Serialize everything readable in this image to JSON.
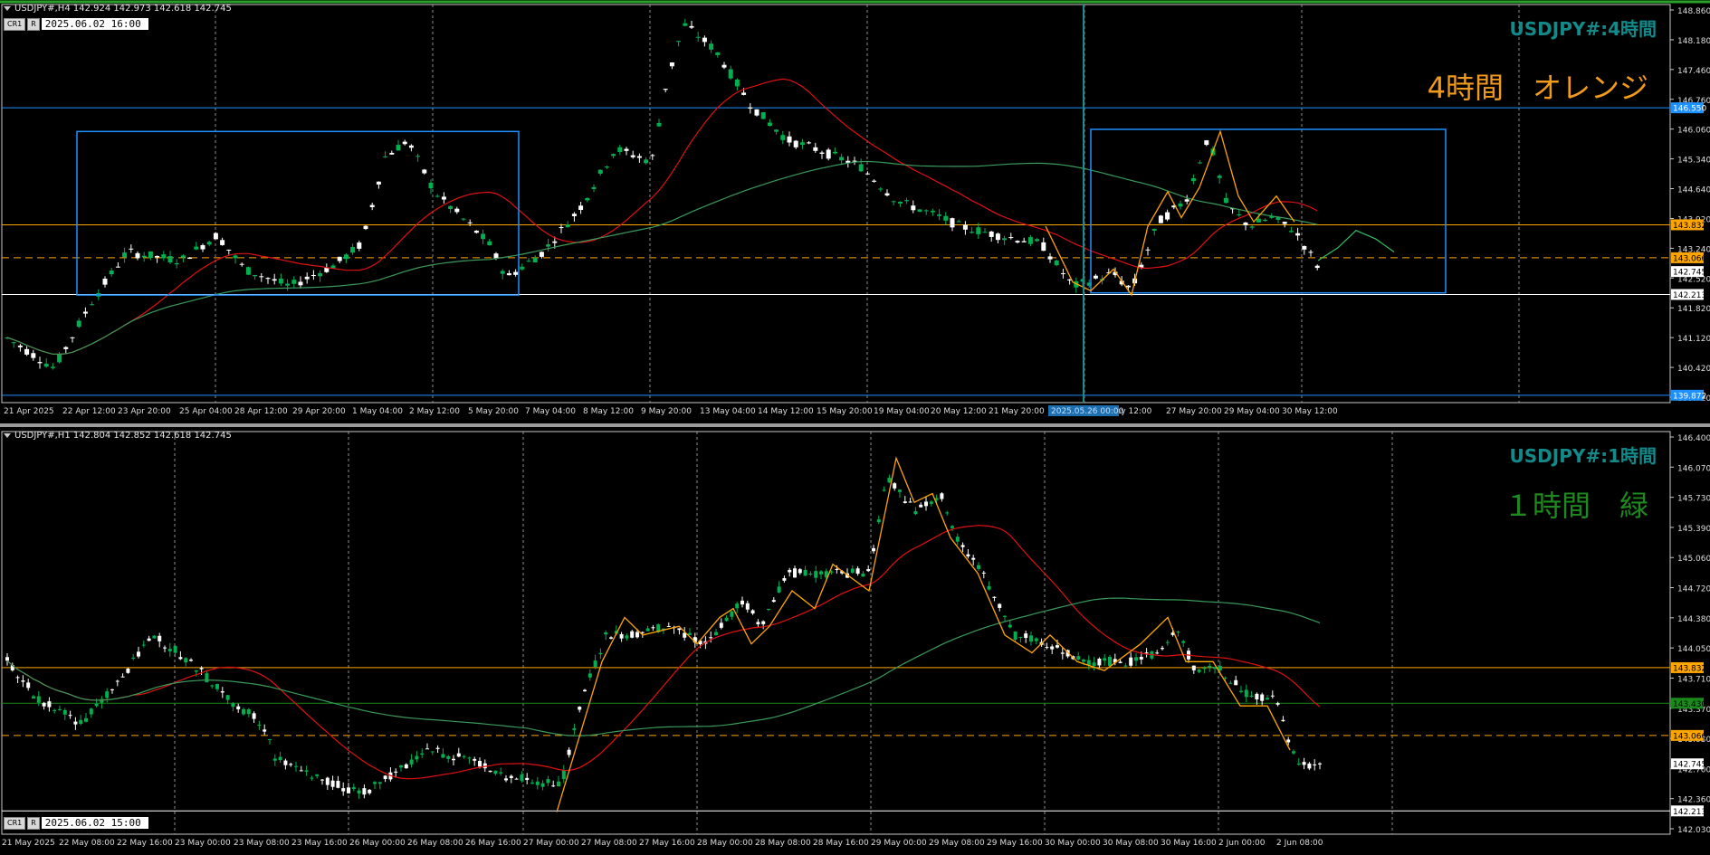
{
  "colors": {
    "up_candle": "#00b050",
    "down_candle": "#ffffff",
    "grid": "#b0b0b0",
    "axis_text": "#dddddd",
    "ma_red": "#e01010",
    "ma_green": "#3a9a5a",
    "zigzag": "#ffa500",
    "box": "#1e90ff",
    "line_orange": "#ffa500",
    "line_white": "#ffffff",
    "line_blue": "#1e90ff",
    "line_green": "#1a8a1a",
    "watermark_cyan": "#138a8a",
    "watermark_orange": "#f29b1a",
    "watermark_green": "#1e8a1e"
  },
  "top_panel": {
    "header": "USDJPY#,H4  142.924 142.973 142.618 142.745",
    "watermark_title": "USDJPY#:4時間",
    "watermark_sub": "4時間　オレンジ",
    "button_cr": "CR1",
    "button_r": "R",
    "cursor_date": "2025.06.02  16:00",
    "y_ticks": [
      "148.860",
      "148.180",
      "147.460",
      "146.760",
      "146.060",
      "145.340",
      "144.640",
      "143.920",
      "143.240",
      "142.520",
      "141.820",
      "141.120",
      "140.420",
      "139.720"
    ],
    "y_min": 139.7,
    "y_max": 148.95,
    "x_ticks": [
      "21 Apr 2025",
      "22 Apr 12:00",
      "23 Apr 20:00",
      "25 Apr 04:00",
      "28 Apr 12:00",
      "29 Apr 20:00",
      "1 May 04:00",
      "2 May 12:00",
      "5 May 20:00",
      "7 May 04:00",
      "8 May 12:00",
      "9 May 20:00",
      "13 May 04:00",
      "14 May 12:00",
      "15 May 20:00",
      "19 May 04:00",
      "20 May 12:00",
      "21 May 20:00",
      "May 12:00",
      "27 May 20:00",
      "29 May 04:00",
      "30 May 12:00"
    ],
    "highlight_date": "2025.05.26 00:00",
    "price_labels": [
      {
        "price": 146.55,
        "text": "146.550",
        "style": "blue"
      },
      {
        "price": 143.832,
        "text": "143.832",
        "style": "orange"
      },
      {
        "price": 143.066,
        "text": "143.066",
        "style": "orange_dash"
      },
      {
        "price": 142.745,
        "text": "142.745",
        "style": "white_box"
      },
      {
        "price": 142.213,
        "text": "142.213",
        "style": "white"
      },
      {
        "price": 139.872,
        "text": "139.872",
        "style": "blue"
      }
    ]
  },
  "bottom_panel": {
    "header": "USDJPY#,H1  142.804 142.852 142.618 142.745",
    "watermark_title": "USDJPY#:1時間",
    "watermark_sub": "１時間　緑",
    "button_cr": "CR1",
    "button_r": "R",
    "cursor_date": "2025.06.02  15:00",
    "y_ticks": [
      "146.400",
      "146.070",
      "145.730",
      "145.390",
      "145.060",
      "144.720",
      "144.380",
      "144.050",
      "143.710",
      "143.370",
      "143.030",
      "142.700",
      "142.360",
      "142.030"
    ],
    "y_min": 141.95,
    "y_max": 146.5,
    "x_ticks": [
      "21 May 2025",
      "22 May 08:00",
      "22 May 16:00",
      "23 May 00:00",
      "23 May 08:00",
      "23 May 16:00",
      "26 May 00:00",
      "26 May 08:00",
      "26 May 16:00",
      "27 May 00:00",
      "27 May 08:00",
      "27 May 16:00",
      "28 May 00:00",
      "28 May 08:00",
      "28 May 16:00",
      "29 May 00:00",
      "29 May 08:00",
      "29 May 16:00",
      "30 May 00:00",
      "30 May 08:00",
      "30 May 16:00",
      "2 Jun 00:00",
      "2 Jun 08:00"
    ],
    "price_labels": [
      {
        "price": 143.832,
        "text": "143.832",
        "style": "orange"
      },
      {
        "price": 143.43,
        "text": "143.430",
        "style": "green"
      },
      {
        "price": 143.066,
        "text": "143.066",
        "style": "orange_dash"
      },
      {
        "price": 142.745,
        "text": "142.745",
        "style": "white_box"
      },
      {
        "price": 142.213,
        "text": "142.213",
        "style": "white"
      }
    ]
  }
}
